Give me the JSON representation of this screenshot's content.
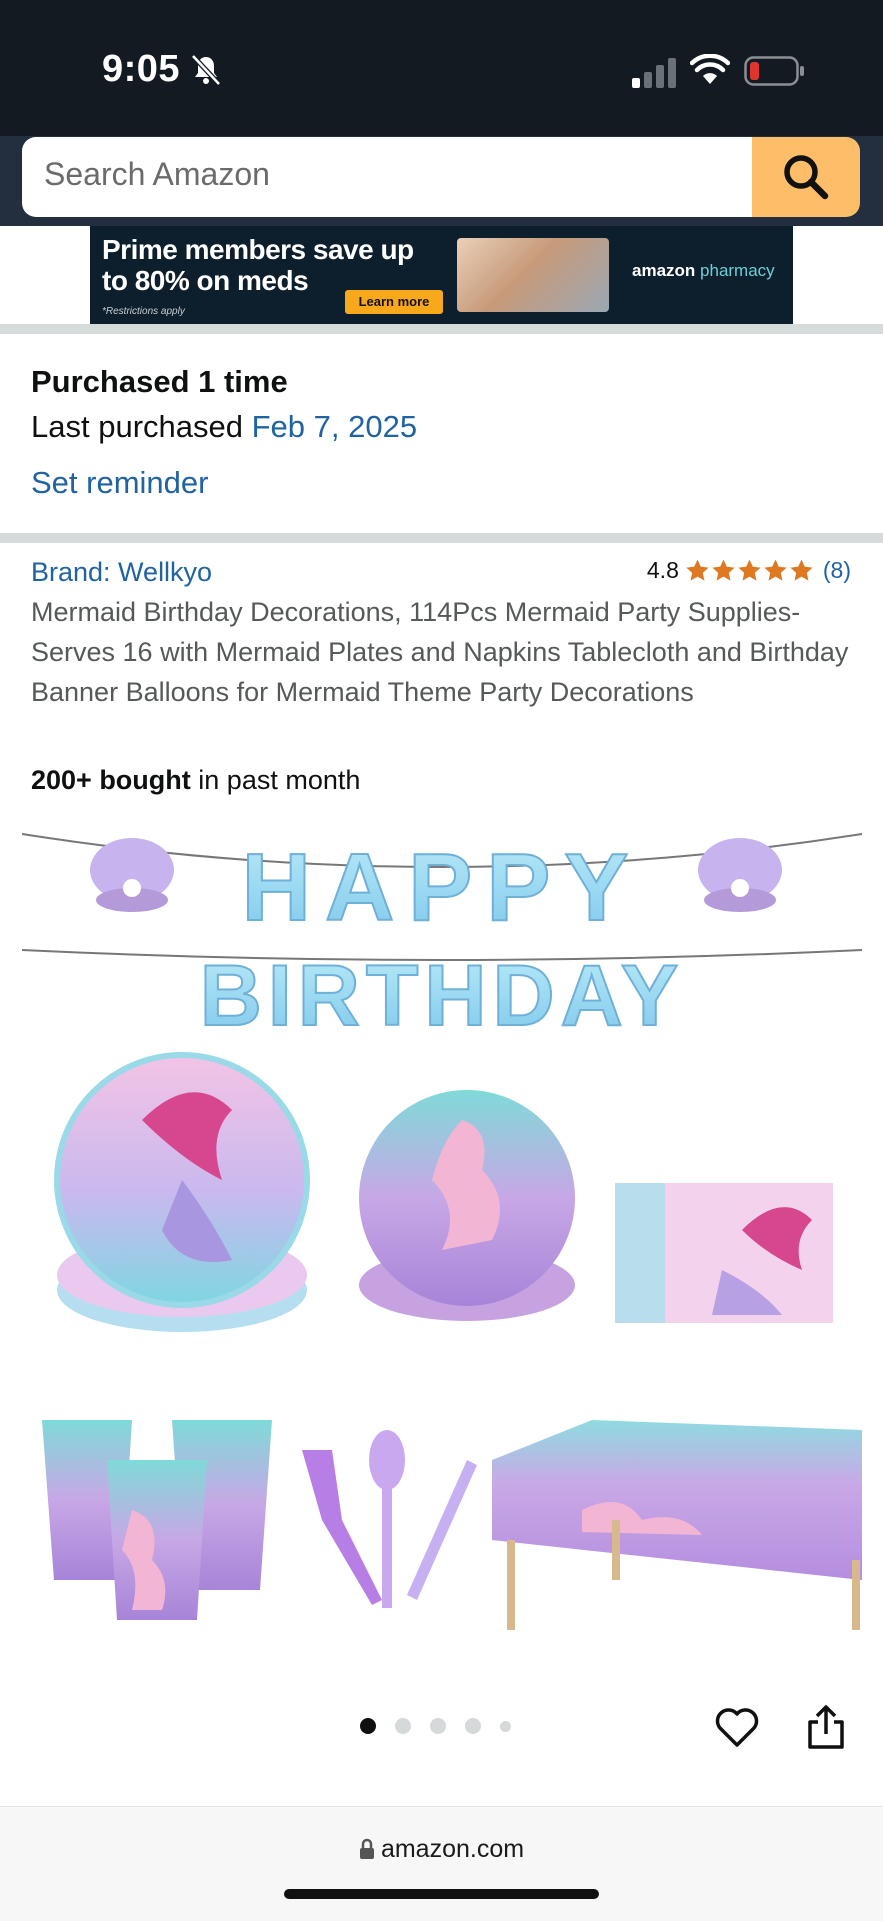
{
  "status_bar": {
    "time": "9:05",
    "icons": [
      "bell-slash-icon",
      "signal-icon",
      "wifi-icon",
      "battery-low-icon"
    ],
    "battery_color": "#e0342e"
  },
  "search": {
    "placeholder": "Search Amazon",
    "button_icon": "search-icon",
    "button_color": "#febd69"
  },
  "banner": {
    "headline": "Prime members save up\nto 80% on meds",
    "cta": "Learn more",
    "restriction": "*Restrictions apply",
    "brand_amazon": "amazon",
    "brand_pharmacy": "pharmacy"
  },
  "purchase_history": {
    "times": "Purchased 1 time",
    "last_label": "Last purchased",
    "last_date": "Feb 7, 2025",
    "reminder": "Set reminder"
  },
  "product": {
    "brand": "Brand: Wellkyo",
    "rating": "4.8",
    "stars": 4.8,
    "rating_count": "(8)",
    "title": "Mermaid Birthday Decorations, 114Pcs Mermaid Party Supplies-Serves 16 with Mermaid Plates and Napkins Tablecloth and Birthday Banner Balloons for Mermaid Theme Party Decorations",
    "bought_strong": "200+ bought",
    "bought_rest": " in past month",
    "banner_line1": "HAPPY",
    "banner_line2": "BIRTHDAY"
  },
  "carousel": {
    "total_dots": 5,
    "active_index": 0
  },
  "actions": [
    "heart-icon",
    "share-icon"
  ],
  "browser": {
    "url": "amazon.com"
  }
}
